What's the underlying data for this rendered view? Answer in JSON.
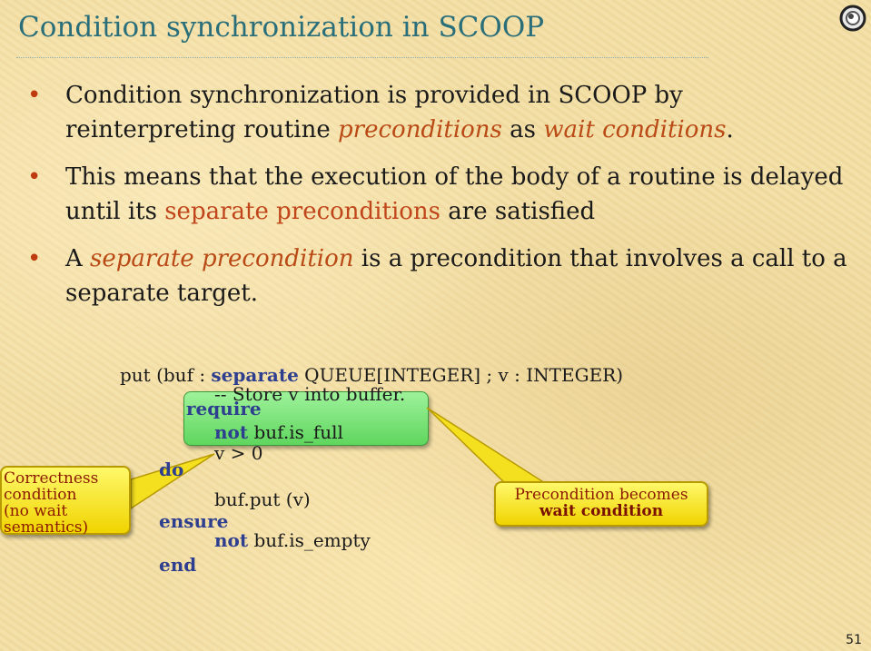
{
  "title": "Condition synchronization in SCOOP",
  "bullets": {
    "b1": {
      "pre": "Condition synchronization is provided in SCOOP by reinterpreting routine ",
      "em1": "preconditions",
      "mid": " as ",
      "em2": "wait conditions",
      "post": "."
    },
    "b2": {
      "pre": "This means that the execution of the body of a routine is delayed until its ",
      "hl": "separate preconditions",
      "post": " are satisfied"
    },
    "b3": {
      "pre": "A ",
      "em": "separate precondition",
      "post": " is a precondition that involves a call to a separate target."
    }
  },
  "code": {
    "l1_pre": "put (buf : ",
    "l1_kw": "separate",
    "l1_post": " QUEUE[INTEGER] ; v : INTEGER)",
    "l2": "-- Store v into buffer.",
    "require": "require",
    "l4_kw": "not",
    "l4_rest": " buf.is_full",
    "l5": "v > 0",
    "do": "do",
    "l7": "buf.put (v)",
    "ensure": "ensure",
    "l9_kw": "not",
    "l9_rest": " buf.is_empty",
    "end": "end"
  },
  "callouts": {
    "left": {
      "line1": "Correctness",
      "line2": "condition",
      "line3": "(no wait",
      "line4": "semantics)"
    },
    "right": {
      "line1": "Precondition becomes",
      "line2": "wait condition"
    }
  },
  "slide_number": "51"
}
